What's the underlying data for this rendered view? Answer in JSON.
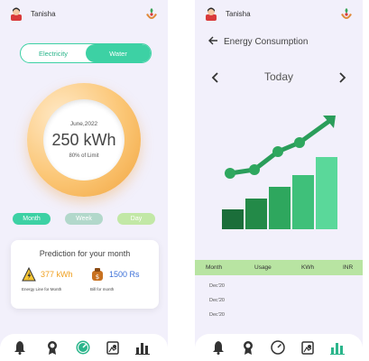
{
  "user": {
    "name": "Tanisha"
  },
  "energy": {
    "toggle": {
      "electricity_label": "Electricity",
      "water_label": "Water",
      "active": "Water"
    },
    "ring": {
      "date": "June,2022",
      "value": "250 kWh",
      "limit_text": "80% of Limit"
    },
    "periods": {
      "month": "Month",
      "week": "Week",
      "day": "Day"
    },
    "prediction": {
      "title": "Prediction for your month",
      "energy_value": "377 kWh",
      "energy_caption": "Energy Line for Month",
      "bill_value": "1500 Rs",
      "bill_caption": "Bill for month"
    }
  },
  "consumption": {
    "title": "Energy Consumption",
    "day_label": "Today",
    "table": {
      "headers": {
        "month": "Month",
        "usage": "Usage",
        "kwh": "KWh",
        "inr": "INR"
      },
      "rows": [
        "Dec'20",
        "Dec'20",
        "Dec'20"
      ]
    }
  },
  "icons": {
    "nav": [
      "bell-icon",
      "medal-icon",
      "gauge-icon",
      "bill-icon",
      "bar-chart-icon"
    ],
    "header": [
      "avatar-icon",
      "leaf-hands-icon"
    ]
  },
  "colors": {
    "accent": "#3dd1a4",
    "ring_orange": "#f1a43e",
    "energy_orange": "#f0a020",
    "bill_blue": "#3b6fd8",
    "table_header": "#b8e4a2",
    "nav_active": "#2bb58b"
  }
}
